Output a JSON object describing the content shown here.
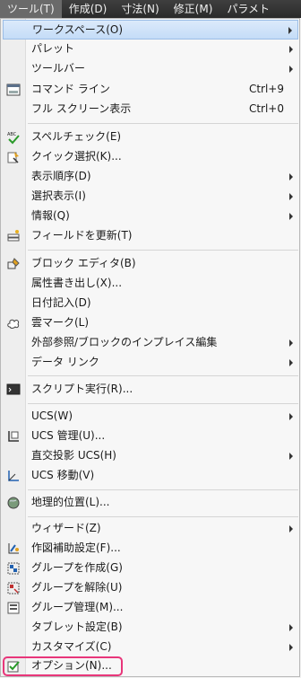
{
  "menubar": [
    "ツール(T)",
    "作成(D)",
    "寸法(N)",
    "修正(M)",
    "パラメト"
  ],
  "items": [
    {
      "label": "ワークスペース(O)"
    },
    {
      "label": "パレット"
    },
    {
      "label": "ツールバー"
    },
    {
      "label": "コマンド ライン",
      "shortcut": "Ctrl+9",
      "icon": "command-line-icon"
    },
    {
      "label": "フル スクリーン表示",
      "shortcut": "Ctrl+0"
    },
    {
      "label": "スペルチェック(E)",
      "icon": "spellcheck-icon"
    },
    {
      "label": "クイック選択(K)...",
      "icon": "quick-select-icon"
    },
    {
      "label": "表示順序(D)"
    },
    {
      "label": "選択表示(I)"
    },
    {
      "label": "情報(Q)"
    },
    {
      "label": "フィールドを更新(T)",
      "icon": "update-field-icon"
    },
    {
      "label": "ブロック エディタ(B)",
      "icon": "block-editor-icon"
    },
    {
      "label": "属性書き出し(X)..."
    },
    {
      "label": "日付記入(D)"
    },
    {
      "label": "雲マーク(L)",
      "icon": "revision-cloud-icon"
    },
    {
      "label": "外部参照/ブロックのインプレイス編集"
    },
    {
      "label": "データ リンク"
    },
    {
      "label": "スクリプト実行(R)...",
      "icon": "script-icon"
    },
    {
      "label": "UCS(W)"
    },
    {
      "label": "UCS 管理(U)...",
      "icon": "ucs-manager-icon"
    },
    {
      "label": "直交投影 UCS(H)"
    },
    {
      "label": "UCS 移動(V)",
      "icon": "ucs-move-icon"
    },
    {
      "label": "地理的位置(L)...",
      "icon": "geolocation-icon"
    },
    {
      "label": "ウィザード(Z)"
    },
    {
      "label": "作図補助設定(F)...",
      "icon": "drafting-settings-icon"
    },
    {
      "label": "グループを作成(G)",
      "icon": "group-create-icon"
    },
    {
      "label": "グループを解除(U)",
      "icon": "ungroup-icon"
    },
    {
      "label": "グループ管理(M)...",
      "icon": "group-manager-icon"
    },
    {
      "label": "タブレット設定(B)"
    },
    {
      "label": "カスタマイズ(C)"
    },
    {
      "label": "オプション(N)...",
      "icon": "options-check-icon"
    }
  ]
}
